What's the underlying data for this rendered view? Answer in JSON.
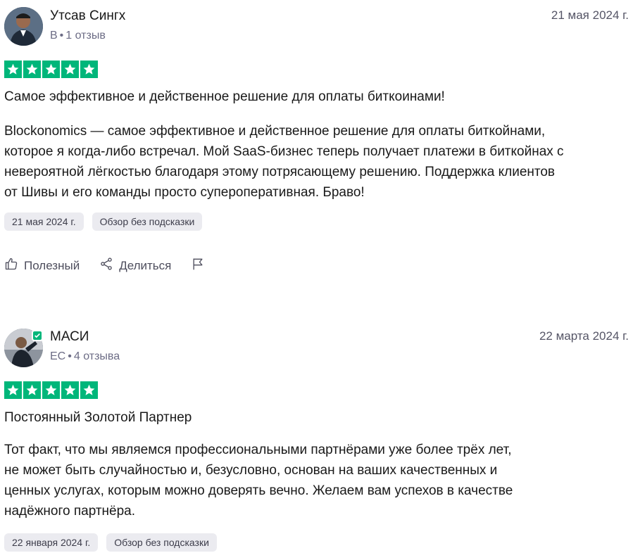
{
  "reviews": [
    {
      "name": "Утсав Сингх",
      "country": "В",
      "review_count": "1 отзыв",
      "date": "21 мая 2024 г.",
      "rating": 5,
      "verified": false,
      "title": "Самое эффективное и действенное решение для оплаты биткоинами!",
      "body_lines": [
        "Blockonomics — самое эффективное и действенное решение для оплаты биткойнами,",
        "которое я когда-либо встречал. Мой SaaS-бизнес теперь получает платежи в биткойнах с",
        "невероятной лёгкостью благодаря этому потрясающему решению. Поддержка клиентов",
        "от Шивы и его команды просто супероперативная. Браво!"
      ],
      "experience_date": "21 мая 2024 г.",
      "tag": "Обзор без подсказки",
      "helpful_label": "Полезный",
      "share_label": "Делиться"
    },
    {
      "name": "МАСИ",
      "country": "ЕС",
      "review_count": "4 отзыва",
      "date": "22 марта 2024 г.",
      "rating": 5,
      "verified": true,
      "title": "Постоянный Золотой Партнер",
      "body_lines": [
        "Тот факт, что мы являемся профессиональными партнёрами уже более трёх лет,",
        "не может быть случайностью и, безусловно, основан на ваших качественных и",
        "ценных услугах, которым можно доверять вечно. Желаем вам успехов в качестве",
        "надёжного партнёра."
      ],
      "experience_date": "22 января 2024 г.",
      "tag": "Обзор без подсказки"
    }
  ],
  "colors": {
    "star_green": "#00b67a",
    "chip_bg": "#ebebf0"
  }
}
